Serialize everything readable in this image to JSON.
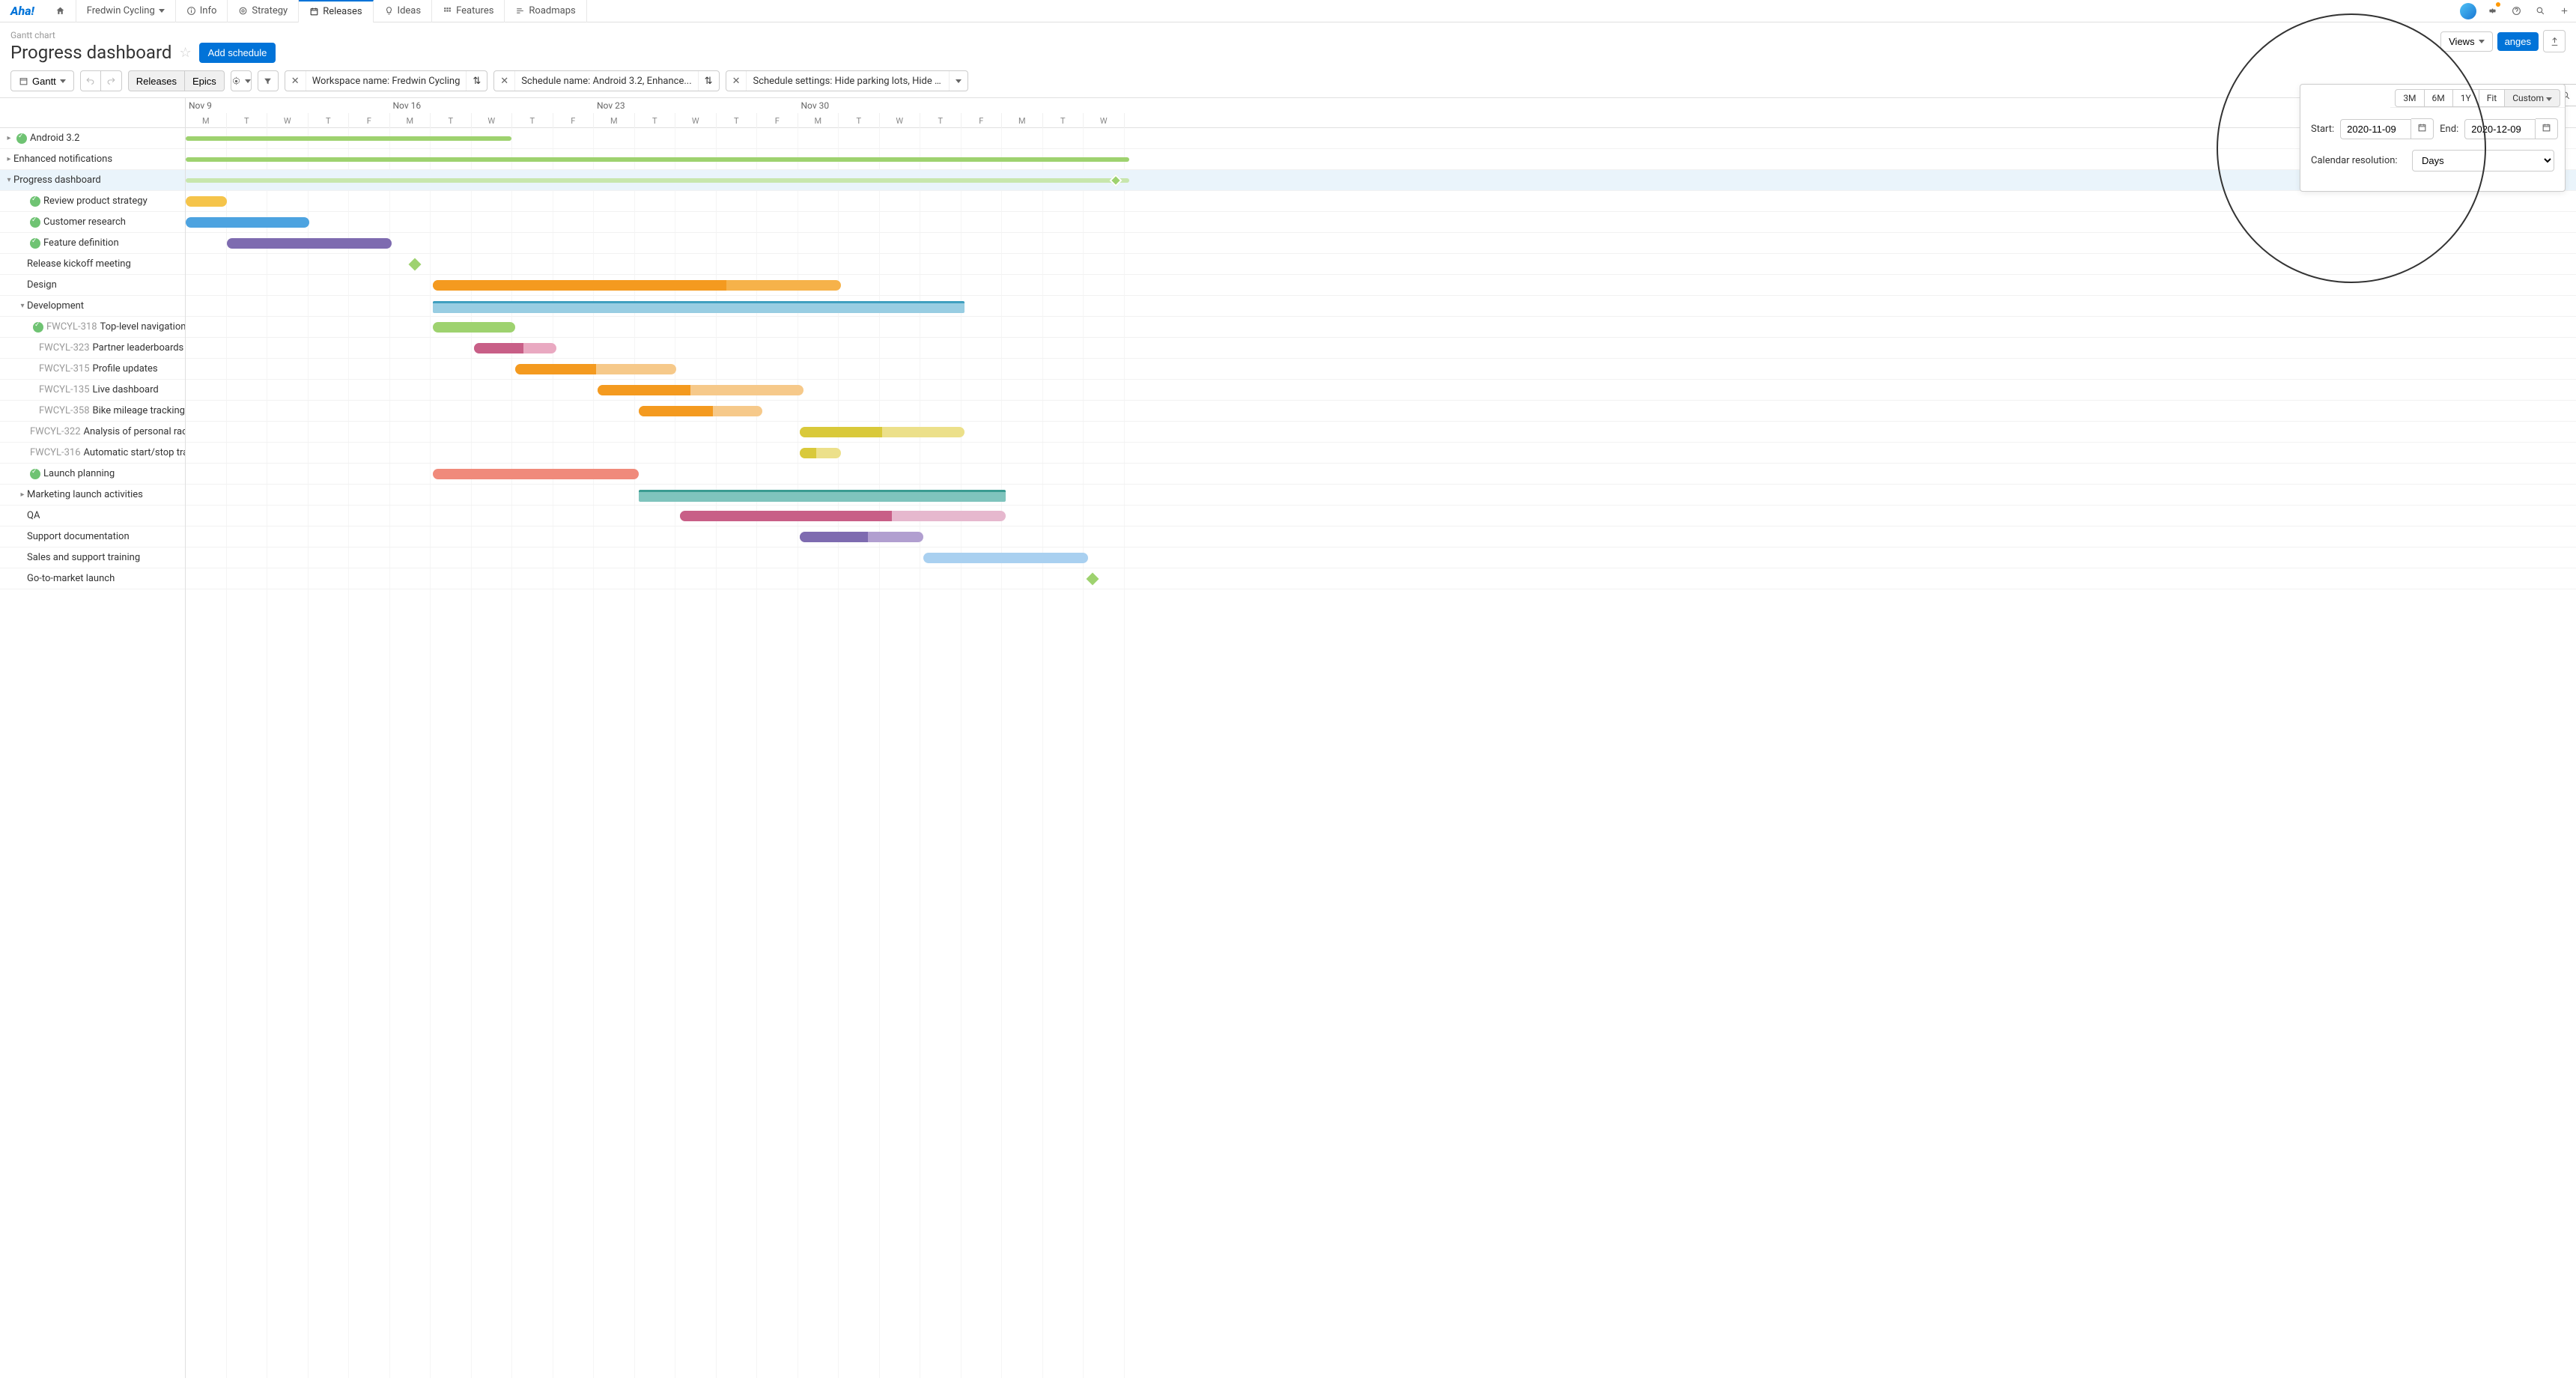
{
  "brand": "Aha!",
  "nav": {
    "workspace": "Fredwin Cycling",
    "items": [
      {
        "label": "Info"
      },
      {
        "label": "Strategy"
      },
      {
        "label": "Releases",
        "active": true
      },
      {
        "label": "Ideas"
      },
      {
        "label": "Features"
      },
      {
        "label": "Roadmaps"
      }
    ]
  },
  "breadcrumb": "Gantt chart",
  "title": "Progress dashboard",
  "addScheduleLabel": "Add schedule",
  "viewsLabel": "Views",
  "shareChangesLabel": "anges",
  "toolbar": {
    "ganttLabel": "Gantt",
    "chips": [
      "Releases",
      "Epics"
    ],
    "filters": [
      {
        "text": "Workspace name: Fredwin Cycling"
      },
      {
        "text": "Schedule name: Android 3.2, Enhance..."
      },
      {
        "text": "Schedule settings: Hide parking lots, Hide shi..."
      }
    ]
  },
  "timeline": {
    "weeks": [
      {
        "label": "Nov 9",
        "days": [
          "M",
          "T",
          "W",
          "T",
          "F"
        ]
      },
      {
        "label": "Nov 16",
        "days": [
          "M",
          "T",
          "W",
          "T",
          "F"
        ]
      },
      {
        "label": "Nov 23",
        "days": [
          "M",
          "T",
          "W",
          "T",
          "F"
        ]
      },
      {
        "label": "Nov 30",
        "days": [
          "M",
          "T",
          "W",
          "T",
          "F"
        ]
      },
      {
        "label": "",
        "days": [
          "M",
          "T",
          "W"
        ]
      }
    ]
  },
  "rows": [
    {
      "label": "Android 3.2",
      "indent": 0,
      "expand": "right",
      "check": true
    },
    {
      "label": "Enhanced notifications",
      "indent": 0,
      "expand": "right"
    },
    {
      "label": "Progress dashboard",
      "indent": 0,
      "expand": "down",
      "hl": true
    },
    {
      "label": "Review product strategy",
      "indent": 1,
      "check": true
    },
    {
      "label": "Customer research",
      "indent": 1,
      "check": true
    },
    {
      "label": "Feature definition",
      "indent": 1,
      "check": true
    },
    {
      "label": "Release kickoff meeting",
      "indent": 1
    },
    {
      "label": "Design",
      "indent": 1
    },
    {
      "label": "Development",
      "indent": 1,
      "expand": "down"
    },
    {
      "label": "Top-level navigation redesi...",
      "indent": 2,
      "check": true,
      "code": "FWCYL-318"
    },
    {
      "label": "Partner leaderboards",
      "indent": 2,
      "code": "FWCYL-323"
    },
    {
      "label": "Profile updates",
      "indent": 2,
      "code": "FWCYL-315"
    },
    {
      "label": "Live dashboard",
      "indent": 2,
      "code": "FWCYL-135"
    },
    {
      "label": "Bike mileage tracking",
      "indent": 2,
      "code": "FWCYL-358"
    },
    {
      "label": "Analysis of personal race goals",
      "indent": 2,
      "code": "FWCYL-322"
    },
    {
      "label": "Automatic start/stop tracking",
      "indent": 2,
      "code": "FWCYL-316"
    },
    {
      "label": "Launch planning",
      "indent": 1,
      "check": true
    },
    {
      "label": "Marketing launch activities",
      "indent": 1,
      "expand": "right"
    },
    {
      "label": "QA",
      "indent": 1
    },
    {
      "label": "Support documentation",
      "indent": 1
    },
    {
      "label": "Sales and support training",
      "indent": 1
    },
    {
      "label": "Go-to-market launch",
      "indent": 1
    }
  ],
  "zoom": {
    "tabs": [
      "3M",
      "6M",
      "1Y",
      "Fit",
      "Custom"
    ],
    "activeTab": "Custom",
    "startLabel": "Start:",
    "endLabel": "End:",
    "start": "2020-11-09",
    "end": "2020-12-09",
    "resLabel": "Calendar resolution:",
    "resValue": "Days"
  },
  "chart_data": {
    "type": "gantt",
    "title": "Progress dashboard",
    "xrange": [
      "2020-11-09",
      "2020-12-09"
    ],
    "bars": [
      {
        "row": 0,
        "start": 0,
        "len": 435,
        "color": "#9ed26f",
        "thin": true
      },
      {
        "row": 1,
        "start": 0,
        "len": 1260,
        "color": "#9ed26f",
        "thin": true
      },
      {
        "row": 2,
        "start": 0,
        "len": 1260,
        "color": "#c8e6ad",
        "thin": true,
        "hl": true,
        "milestoneEnd": true,
        "milestoneColor": "#9ed26f"
      },
      {
        "row": 3,
        "start": 0,
        "len": 55,
        "color": "#f5c44a"
      },
      {
        "row": 4,
        "start": 0,
        "len": 165,
        "color": "#4da3e0"
      },
      {
        "row": 5,
        "start": 55,
        "len": 220,
        "color": "#7e6bb0"
      },
      {
        "row": 6,
        "milestone": true,
        "start": 300,
        "color": "#9ed26f"
      },
      {
        "row": 7,
        "start": 330,
        "len": 545,
        "color": "#f6b24a",
        "progress": 0.72,
        "progColor": "#f49a1f"
      },
      {
        "row": 8,
        "start": 330,
        "len": 710,
        "color": "#98cde2",
        "medium": true,
        "topbar": "#3f9fbf"
      },
      {
        "row": 9,
        "start": 330,
        "len": 110,
        "color": "#9ed26f"
      },
      {
        "row": 10,
        "start": 385,
        "len": 110,
        "color": "#e9a9c1",
        "progress": 0.6,
        "progColor": "#c85f87"
      },
      {
        "row": 11,
        "start": 440,
        "len": 215,
        "color": "#f6c98a",
        "progress": 0.5,
        "progColor": "#f49a1f"
      },
      {
        "row": 12,
        "start": 550,
        "len": 275,
        "color": "#f6c98a",
        "progress": 0.45,
        "progColor": "#f49a1f"
      },
      {
        "row": 13,
        "start": 605,
        "len": 165,
        "color": "#f6c98a",
        "progress": 0.6,
        "progColor": "#f49a1f"
      },
      {
        "row": 14,
        "start": 820,
        "len": 220,
        "color": "#ece08a",
        "progress": 0.5,
        "progColor": "#d9c93a"
      },
      {
        "row": 15,
        "start": 820,
        "len": 55,
        "color": "#ece08a",
        "progress": 0.4,
        "progColor": "#d9c93a"
      },
      {
        "row": 16,
        "start": 330,
        "len": 275,
        "color": "#f08a7b"
      },
      {
        "row": 17,
        "start": 605,
        "len": 490,
        "color": "#7fc4bd",
        "medium": true,
        "topbar": "#3a9b91"
      },
      {
        "row": 18,
        "start": 660,
        "len": 435,
        "color": "#e6b8ce",
        "progress": 0.65,
        "progColor": "#c85f87"
      },
      {
        "row": 19,
        "start": 820,
        "len": 165,
        "color": "#b19fd0",
        "progress": 0.55,
        "progColor": "#7e6bb0"
      },
      {
        "row": 20,
        "start": 985,
        "len": 220,
        "color": "#a9d0f0"
      },
      {
        "row": 21,
        "milestone": true,
        "start": 1205,
        "color": "#9ed26f"
      }
    ]
  }
}
